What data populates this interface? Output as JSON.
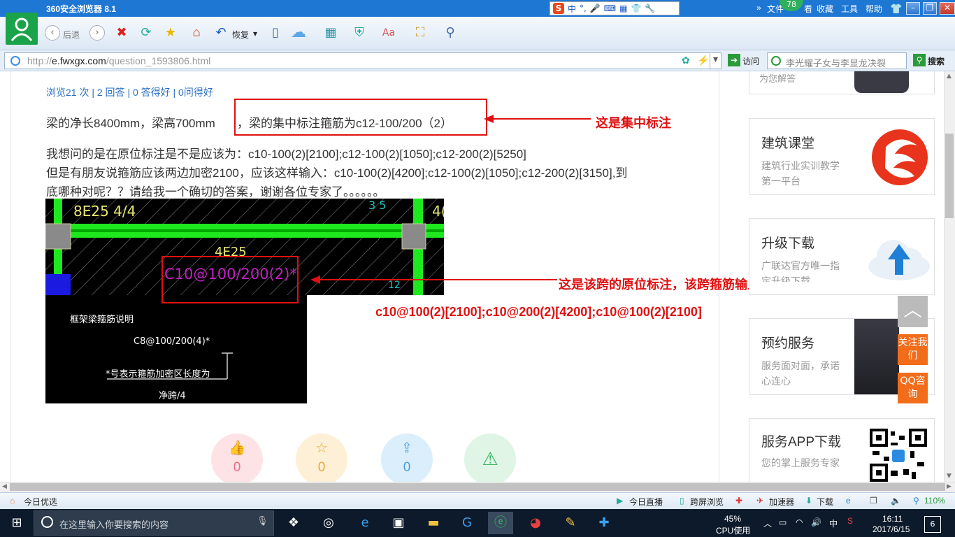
{
  "browser": {
    "title": "360安全浏览器 8.1",
    "menu": [
      "文件",
      "查看",
      "收藏",
      "工具",
      "帮助"
    ],
    "badge": "78",
    "ime": {
      "lang": "中",
      "punct": "°,"
    },
    "toolbar": {
      "back": "后退",
      "restore": "恢复"
    },
    "address": {
      "scheme": "http://",
      "domain": "e.fwxgx.com",
      "path": "/question_1593806.html"
    },
    "visit": "访问",
    "search_placeholder": "李光耀子女与李显龙决裂",
    "search_button": "搜索"
  },
  "question": {
    "stats": "浏览21 次 | 2 回答 | 0 答得好 | 0问得好",
    "line1a": "梁的净长8400mm，梁高700mm",
    "line1b": "，梁的集中标注箍筋为c12-100/200（2）",
    "line2": "我想问的是在原位标注是不是应该为：c10-100(2)[2100];c12-100(2)[1050];c12-200(2)[5250]",
    "line3": "但是有朋友说箍筋应该两边加密2100，应该这样输入：c10-100(2)[4200];c12-100(2)[1050];c12-200(2)[3150],到",
    "line4": "底哪种对呢？？请给我一个确切的答案，谢谢各位专家了。。。。。。"
  },
  "annotations": {
    "central": "这是集中标注",
    "inplace": "这是该跨的原位标注，该跨箍筋输入为",
    "formula": "c10@100(2)[2100];c10@200(2)[4200];c10@100(2)[2100]"
  },
  "cad": {
    "top_label": "8E25 4/4",
    "right_label": "4(",
    "corner_label": "3 5",
    "mid_label": "4E25",
    "stirrup_label": "C10@100/200(2)*",
    "side_label": "12",
    "note_title": "框架梁箍筋说明",
    "note_example": "C8@100/200(4)*",
    "note_star": "*号表示箍筋加密区长度为",
    "note_span": "净跨/4"
  },
  "sidebar": {
    "top_partial": "为您解答",
    "cards": [
      {
        "title": "建筑课堂",
        "desc": "建筑行业实训教学第一平台"
      },
      {
        "title": "升级下载",
        "desc": "广联达官方唯一指定升级下载"
      },
      {
        "title": "预约服务",
        "desc": "服务面对面，承诺心连心"
      },
      {
        "title": "服务APP下载",
        "desc": "您的掌上服务专家"
      }
    ]
  },
  "float": {
    "follow": "关注我们",
    "qq": "QQ咨询"
  },
  "actions": {
    "like": "0",
    "fav": "0",
    "share": "0"
  },
  "status": {
    "today": "今日优选",
    "live": "今日直播",
    "cross": "跨屏浏览",
    "speed": "加速器",
    "download": "下载",
    "zoom": "110%"
  },
  "taskbar": {
    "search": "在这里输入你要搜索的内容",
    "cpu_pct": "45%",
    "cpu_label": "CPU使用",
    "ime": "中",
    "time": "16:11",
    "date": "2017/6/15",
    "notif": "6"
  },
  "colors": {
    "accent_blue": "#1f77d4",
    "annotation_red": "#e01010",
    "cad_green": "#1ee81e",
    "cad_magenta": "#c020c0"
  }
}
